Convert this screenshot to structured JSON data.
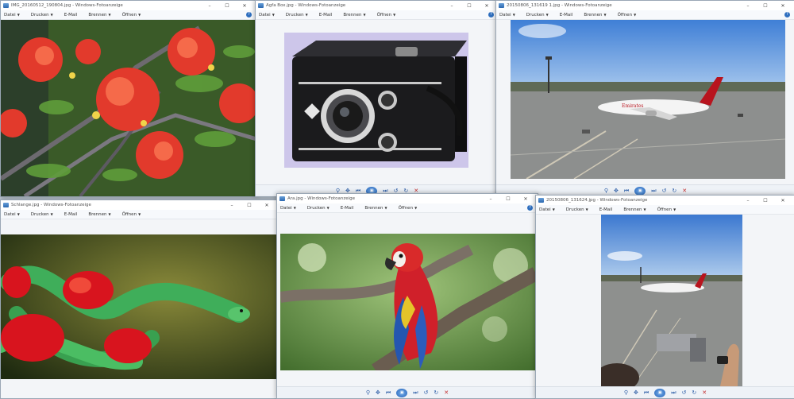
{
  "menu": {
    "datei": "Datei",
    "drucken": "Drucken",
    "email": "E-Mail",
    "brennen": "Brennen",
    "oeffnen": "Öffnen"
  },
  "controls": {
    "minimize": "–",
    "maximize": "☐",
    "close": "✕",
    "help": "?"
  },
  "toolbar": {
    "zoom": "⚲",
    "fit": "✥",
    "prev": "⏮",
    "play": "▣",
    "next": "⏭",
    "rotate_left": "↺",
    "rotate_right": "↻",
    "delete": "✕"
  },
  "windows": [
    {
      "title": "IMG_20160512_190804.jpg - Windows-Fotoanzeige",
      "photo": "red-flowers-tree"
    },
    {
      "title": "Agfa Box.jpg - Windows-Fotoanzeige",
      "photo": "agfa-box-camera"
    },
    {
      "title": "20150806_131619 1.jpg - Windows-Fotoanzeige",
      "photo": "emirates-airplane-apron"
    },
    {
      "title": "Schlange.jpg - Windows-Fotoanzeige",
      "photo": "green-snake-red-flower"
    },
    {
      "title": "Ara.jpg - Windows-Fotoanzeige",
      "photo": "scarlet-macaw-parrot"
    },
    {
      "title": "20150806_131624.jpg - Windows-Fotoanzeige",
      "photo": "airport-view-with-camera"
    }
  ],
  "colors": {
    "accent": "#2f6fbf",
    "delete": "#c43030",
    "agfa_background": "#cdc6ea",
    "macaw_red": "#d0202a",
    "snake_green": "#3fae5a"
  }
}
